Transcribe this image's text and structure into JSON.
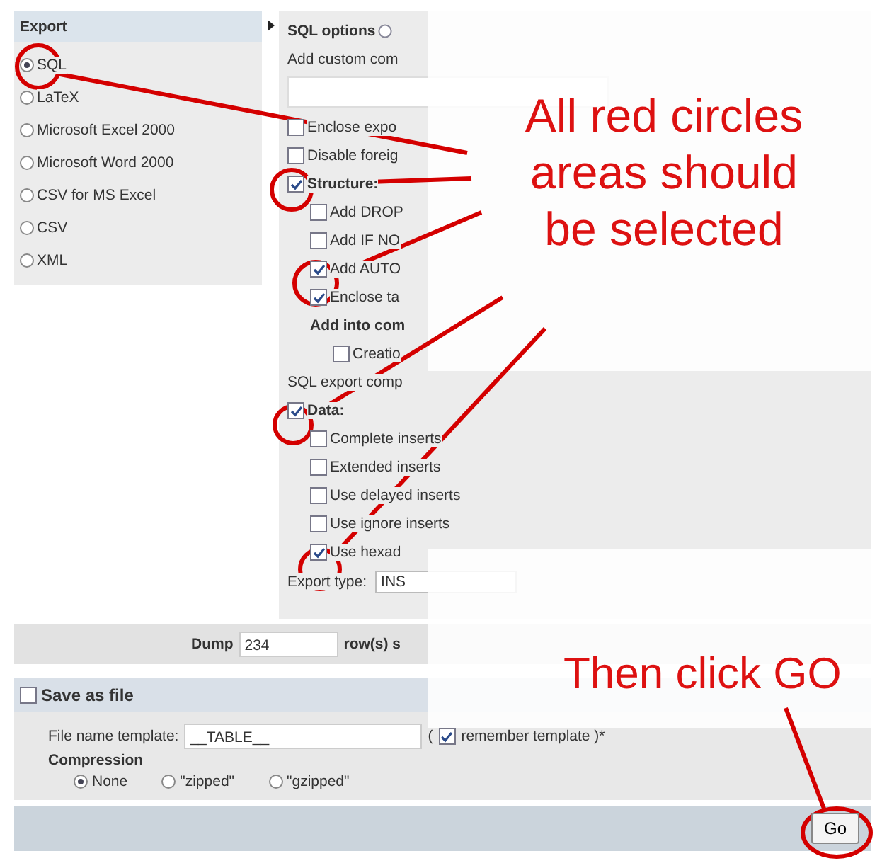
{
  "export_panel": {
    "title": "Export",
    "formats": [
      {
        "label": "SQL",
        "selected": true
      },
      {
        "label": "LaTeX",
        "selected": false
      },
      {
        "label": "Microsoft Excel 2000",
        "selected": false
      },
      {
        "label": "Microsoft Word 2000",
        "selected": false
      },
      {
        "label": "CSV for MS Excel",
        "selected": false
      },
      {
        "label": "CSV",
        "selected": false
      },
      {
        "label": "XML",
        "selected": false
      }
    ]
  },
  "sql_options": {
    "title": "SQL options",
    "comment_label": "Add custom com",
    "options": [
      {
        "kind": "checkbox",
        "label": "Enclose expo",
        "checked": false
      },
      {
        "kind": "checkbox",
        "label": "Disable foreig",
        "checked": false
      },
      {
        "kind": "group",
        "label": "Structure:",
        "checked": true,
        "children": [
          {
            "kind": "checkbox",
            "label": "Add DROP",
            "checked": false
          },
          {
            "kind": "checkbox",
            "label": "Add IF NO",
            "checked": false
          },
          {
            "kind": "checkbox",
            "label": "Add AUTO",
            "checked": true
          },
          {
            "kind": "checkbox",
            "label": "Enclose ta",
            "checked": true
          },
          {
            "kind": "heading",
            "label": "Add into com",
            "children": [
              {
                "kind": "checkbox",
                "label": "Creatio",
                "checked": false
              }
            ]
          }
        ]
      },
      {
        "kind": "label",
        "label": "SQL export comp"
      },
      {
        "kind": "group",
        "label": "Data:",
        "checked": true,
        "children": [
          {
            "kind": "checkbox",
            "label": "Complete inserts",
            "checked": false
          },
          {
            "kind": "checkbox",
            "label": "Extended inserts",
            "checked": false
          },
          {
            "kind": "checkbox",
            "label": "Use delayed inserts",
            "checked": false
          },
          {
            "kind": "checkbox",
            "label": "Use ignore inserts",
            "checked": false
          },
          {
            "kind": "checkbox",
            "label": "Use hexad",
            "checked": true
          }
        ]
      },
      {
        "kind": "select",
        "label": "Export type:",
        "value": "INS"
      }
    ]
  },
  "dump": {
    "label": "Dump",
    "value": "234",
    "suffix": "row(s) s"
  },
  "save_as_file": {
    "label": "Save as file",
    "checked": false,
    "template_label": "File name template:",
    "template_value": "__TABLE__",
    "paren_open": "(",
    "remember_checked": true,
    "remember_label": "remember template )*",
    "compression_label": "Compression",
    "compression": [
      {
        "label": "None",
        "selected": true
      },
      {
        "label": "\"zipped\"",
        "selected": false
      },
      {
        "label": "\"gzipped\"",
        "selected": false
      }
    ]
  },
  "go_button": "Go",
  "annotations": {
    "instruction": "All red circles areas should be selected",
    "action": "Then click GO"
  }
}
